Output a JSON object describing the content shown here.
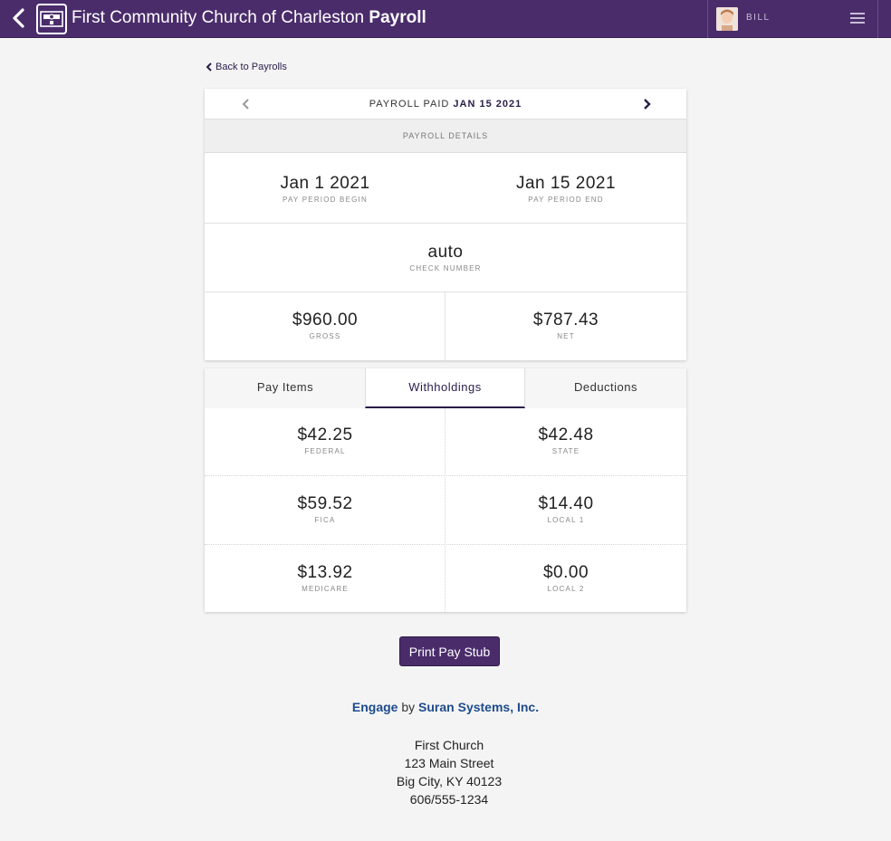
{
  "header": {
    "title_main": "First Community Church of Charleston",
    "title_bold": "Payroll",
    "user_name": "BILL",
    "icons": {
      "back": "chevron-left-icon",
      "logo": "check-logo-icon",
      "menu": "hamburger-menu-icon"
    }
  },
  "back_link": {
    "label": "Back to Payrolls"
  },
  "payroll_nav": {
    "prefix": "PAYROLL PAID",
    "date": "JAN 15 2021"
  },
  "details": {
    "section_label": "PAYROLL DETAILS",
    "pay_period_begin": {
      "value": "Jan 1 2021",
      "label": "PAY PERIOD BEGIN"
    },
    "pay_period_end": {
      "value": "Jan 15 2021",
      "label": "PAY PERIOD END"
    },
    "check_number": {
      "value": "auto",
      "label": "CHECK NUMBER"
    },
    "gross": {
      "value": "$960.00",
      "label": "GROSS"
    },
    "net": {
      "value": "$787.43",
      "label": "NET"
    }
  },
  "tabs": [
    {
      "label": "Pay Items",
      "active": false
    },
    {
      "label": "Withholdings",
      "active": true
    },
    {
      "label": "Deductions",
      "active": false
    }
  ],
  "withholdings": [
    {
      "value": "$42.25",
      "label": "FEDERAL"
    },
    {
      "value": "$42.48",
      "label": "STATE"
    },
    {
      "value": "$59.52",
      "label": "FICA"
    },
    {
      "value": "$14.40",
      "label": "LOCAL 1"
    },
    {
      "value": "$13.92",
      "label": "MEDICARE"
    },
    {
      "value": "$0.00",
      "label": "LOCAL 2"
    }
  ],
  "print_button": {
    "label": "Print Pay Stub"
  },
  "footer": {
    "brand": "Engage",
    "by": "by",
    "company": "Suran Systems, Inc.",
    "address": [
      "First Church",
      "123 Main Street",
      "Big City, KY 40123",
      "606/555-1234"
    ]
  },
  "colors": {
    "header_bg": "#4a2c6b",
    "accent": "#2a1d4a",
    "brand_link": "#1e4b8c",
    "page_bg": "#f4f4f4"
  }
}
